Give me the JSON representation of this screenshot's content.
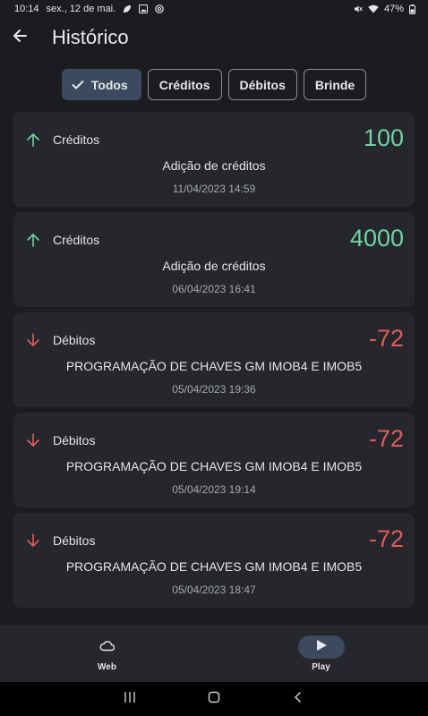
{
  "status_bar": {
    "time": "10:14",
    "date": "sex., 12 de mai.",
    "battery": "47%",
    "icons": [
      "leaf-icon",
      "image-icon",
      "at-icon",
      "mute-icon",
      "wifi-icon",
      "battery-icon"
    ]
  },
  "header": {
    "title": "Histórico"
  },
  "filters": [
    {
      "label": "Todos",
      "selected": true
    },
    {
      "label": "Créditos",
      "selected": false
    },
    {
      "label": "Débitos",
      "selected": false
    },
    {
      "label": "Brinde",
      "selected": false
    }
  ],
  "transactions": [
    {
      "type": "Créditos",
      "direction": "up",
      "amount": "100",
      "description": "Adição de créditos",
      "date": "11/04/2023 14:59"
    },
    {
      "type": "Créditos",
      "direction": "up",
      "amount": "4000",
      "description": "Adição de créditos",
      "date": "06/04/2023 16:41"
    },
    {
      "type": "Débitos",
      "direction": "down",
      "amount": "-72",
      "description": "PROGRAMAÇÃO DE CHAVES GM IMOB4 E IMOB5",
      "date": "05/04/2023 19:36"
    },
    {
      "type": "Débitos",
      "direction": "down",
      "amount": "-72",
      "description": "PROGRAMAÇÃO DE CHAVES GM IMOB4 E IMOB5",
      "date": "05/04/2023 19:14"
    },
    {
      "type": "Débitos",
      "direction": "down",
      "amount": "-72",
      "description": "PROGRAMAÇÃO DE CHAVES GM IMOB4 E IMOB5",
      "date": "05/04/2023 18:47"
    }
  ],
  "bottom_nav": [
    {
      "label": "Web",
      "icon": "cloud-icon",
      "active": false
    },
    {
      "label": "Play",
      "icon": "play-icon",
      "active": true
    }
  ],
  "colors": {
    "credit": "#6fd3a0",
    "debit": "#e45b5b",
    "selected": "#3b4a5e",
    "card": "#25272c",
    "background": "#1b1c20"
  }
}
